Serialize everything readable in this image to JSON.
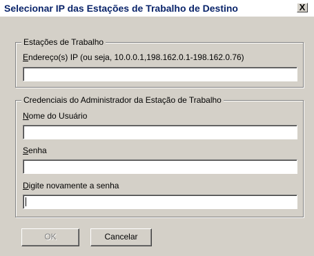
{
  "window": {
    "title": "Selecionar IP das Estações de Trabalho de Destino",
    "close_glyph": "X"
  },
  "workstations_group": {
    "legend": "Estações de Trabalho",
    "ip_label": "Endereço(s) IP (ou seja, 10.0.0.1,198.162.0.1-198.162.0.76)",
    "ip_label_accel": "E",
    "ip_label_rest": "ndereço(s) IP (ou seja, 10.0.0.1,198.162.0.1-198.162.0.76)",
    "ip_value": ""
  },
  "credentials_group": {
    "legend": "Credenciais do Administrador da Estação de Trabalho",
    "username_label_accel": "N",
    "username_label_rest": "ome do Usuário",
    "username_value": "",
    "password_label_accel": "S",
    "password_label_rest": "enha",
    "password_value": "",
    "confirm_label_accel": "D",
    "confirm_label_rest": "igite novamente a senha",
    "confirm_value": ""
  },
  "buttons": {
    "ok_label": "OK",
    "cancel_label": "Cancelar"
  }
}
